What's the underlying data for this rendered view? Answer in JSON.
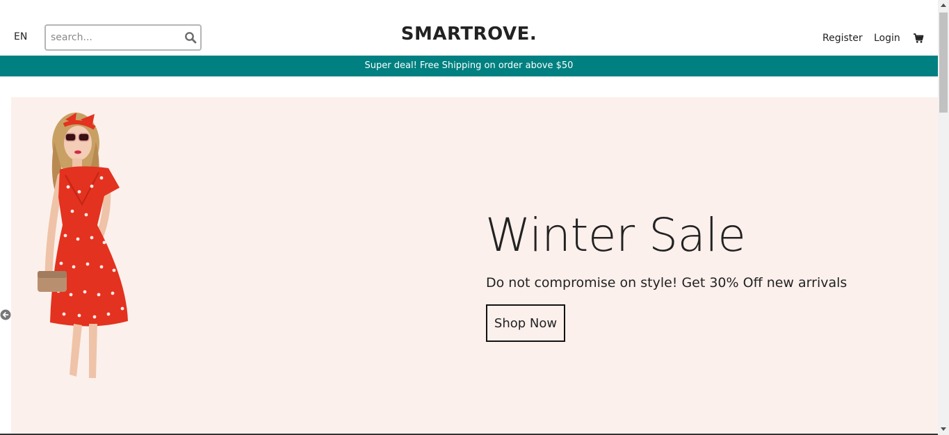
{
  "header": {
    "language": "EN",
    "search": {
      "placeholder": "search...",
      "value": ""
    },
    "brand": "SMARTROVE.",
    "nav": {
      "register": "Register",
      "login": "Login"
    },
    "icons": {
      "search": "search-icon",
      "cart": "cart-icon"
    }
  },
  "promo": {
    "text": "Super deal! Free Shipping on order above $50"
  },
  "hero": {
    "title": "Winter Sale",
    "subtitle": "Do not compromise on style! Get 30% Off new arrivals",
    "cta_label": "Shop Now",
    "image": "woman-in-red-polka-dot-dress"
  },
  "colors": {
    "promo_bar": "#008080",
    "hero_background": "#fbf0ec",
    "dress_red": "#e3321f"
  }
}
